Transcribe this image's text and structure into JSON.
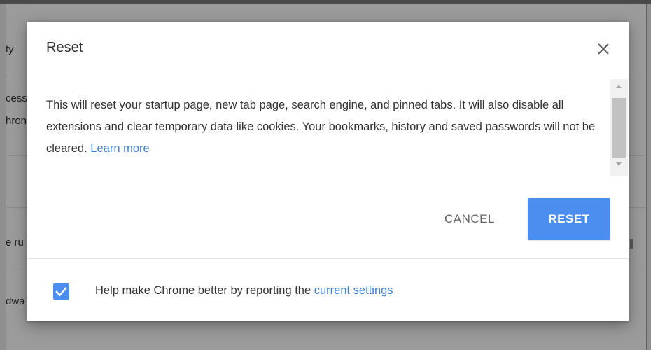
{
  "background": {
    "row_fragments": [
      "ty",
      "cess",
      "hron",
      "e ru",
      "dwa"
    ]
  },
  "dialog": {
    "title": "Reset",
    "close_icon": "close-icon",
    "body": {
      "text": "This will reset your startup page, new tab page, search engine, and pinned tabs. It will also disable all extensions and clear temporary data like cookies. Your bookmarks, history and saved passwords will not be cleared.",
      "learn_more": "Learn more"
    },
    "buttons": {
      "cancel": "CANCEL",
      "reset": "RESET"
    },
    "footer": {
      "checkbox_checked": true,
      "text": "Help make Chrome better by reporting the",
      "link": "current settings"
    }
  },
  "colors": {
    "accent": "#4c8ef0",
    "link": "#3d7fd9",
    "overlay": "#9b9b9b"
  }
}
